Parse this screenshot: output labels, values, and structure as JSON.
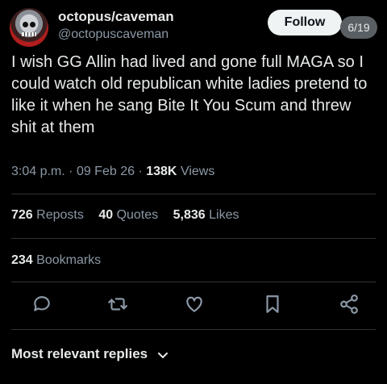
{
  "author": {
    "display_name": "octopus/caveman",
    "handle": "@octopuscaveman"
  },
  "follow_label": "Follow",
  "page_indicator": "6/19",
  "tweet_text": "I wish GG Allin had lived and gone full MAGA so I could watch old republican white ladies pretend to like it when he sang Bite It You Scum and threw shit at them",
  "meta": {
    "time": "3:04 p.m.",
    "sep1": "·",
    "date": "09 Feb 26",
    "sep2": "·",
    "views_count": "138K",
    "views_label": "Views"
  },
  "stats": {
    "reposts_count": "726",
    "reposts_label": "Reposts",
    "quotes_count": "40",
    "quotes_label": "Quotes",
    "likes_count": "5,836",
    "likes_label": "Likes",
    "bookmarks_count": "234",
    "bookmarks_label": "Bookmarks"
  },
  "icons": [
    "reply-icon",
    "repost-icon",
    "like-icon",
    "bookmark-icon",
    "share-icon"
  ],
  "replies_sort_label": "Most relevant replies",
  "colors": {
    "background": "#000000",
    "text": "#e7e9ea",
    "secondary": "#8b98a5",
    "divider": "#2f3336"
  }
}
